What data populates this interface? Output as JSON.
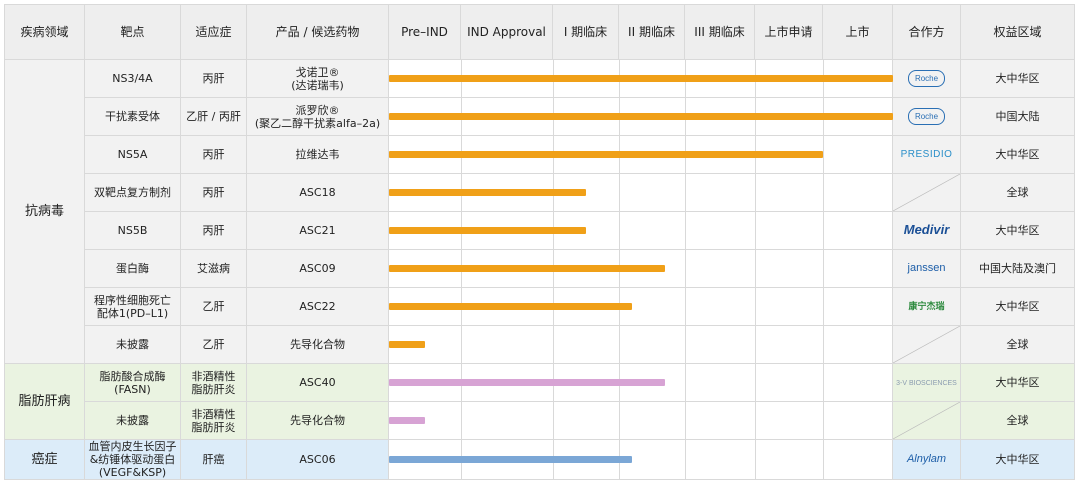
{
  "headers": [
    "疾病领域",
    "靶点",
    "适应症",
    "产品 / 候选药物",
    "Pre–IND",
    "IND Approval",
    "I 期临床",
    "II 期临床",
    "III 期临床",
    "上市申请",
    "上市",
    "合作方",
    "权益区域"
  ],
  "categories": {
    "antiviral": "抗病毒",
    "fatty": "脂肪肝病",
    "cancer": "癌症"
  },
  "rows": [
    {
      "target": "NS3/4A",
      "indication": "丙肝",
      "product": "戈诺卫®\n(达诺瑞韦)",
      "stage": 7,
      "partner": "Roche",
      "region": "大中华区"
    },
    {
      "target": "干扰素受体",
      "indication": "乙肝 / 丙肝",
      "product": "派罗欣®\n(聚乙二醇干扰素alfa–2a)",
      "stage": 7,
      "partner": "Roche",
      "region": "中国大陆"
    },
    {
      "target": "NS5A",
      "indication": "丙肝",
      "product": "拉维达韦",
      "stage": 6,
      "partner": "PRESIDIO",
      "region": "大中华区"
    },
    {
      "target": "双靶点复方制剂",
      "indication": "丙肝",
      "product": "ASC18",
      "stage": 2.5,
      "partner": "",
      "region": "全球"
    },
    {
      "target": "NS5B",
      "indication": "丙肝",
      "product": "ASC21",
      "stage": 2.5,
      "partner": "Medivir",
      "region": "大中华区"
    },
    {
      "target": "蛋白酶",
      "indication": "艾滋病",
      "product": "ASC09",
      "stage": 3.7,
      "partner": "janssen",
      "region": "中国大陆及澳门"
    },
    {
      "target": "程序性细胞死亡\n配体1(PD–L1)",
      "indication": "乙肝",
      "product": "ASC22",
      "stage": 3.2,
      "partner": "康宁杰瑞",
      "region": "大中华区"
    },
    {
      "target": "未披露",
      "indication": "乙肝",
      "product": "先导化合物",
      "stage": 0.5,
      "partner": "",
      "region": "全球"
    },
    {
      "target": "脂肪酸合成酶\n(FASN)",
      "indication": "非酒精性\n脂肪肝炎",
      "product": "ASC40",
      "stage": 3.7,
      "partner": "3-V BIOSCIENCES",
      "region": "大中华区"
    },
    {
      "target": "未披露",
      "indication": "非酒精性\n脂肪肝炎",
      "product": "先导化合物",
      "stage": 0.5,
      "partner": "",
      "region": "全球"
    },
    {
      "target": "血管内皮生长因子\n&纺锤体驱动蛋白\n(VEGF&KSP)",
      "indication": "肝癌",
      "product": "ASC06",
      "stage": 3.2,
      "partner": "Alnylam",
      "region": "大中华区"
    }
  ],
  "colors": {
    "antiviral_bar": "#f0a018",
    "fatty_bar": "#d7a3d4",
    "cancer_bar": "#7ba7d6"
  }
}
